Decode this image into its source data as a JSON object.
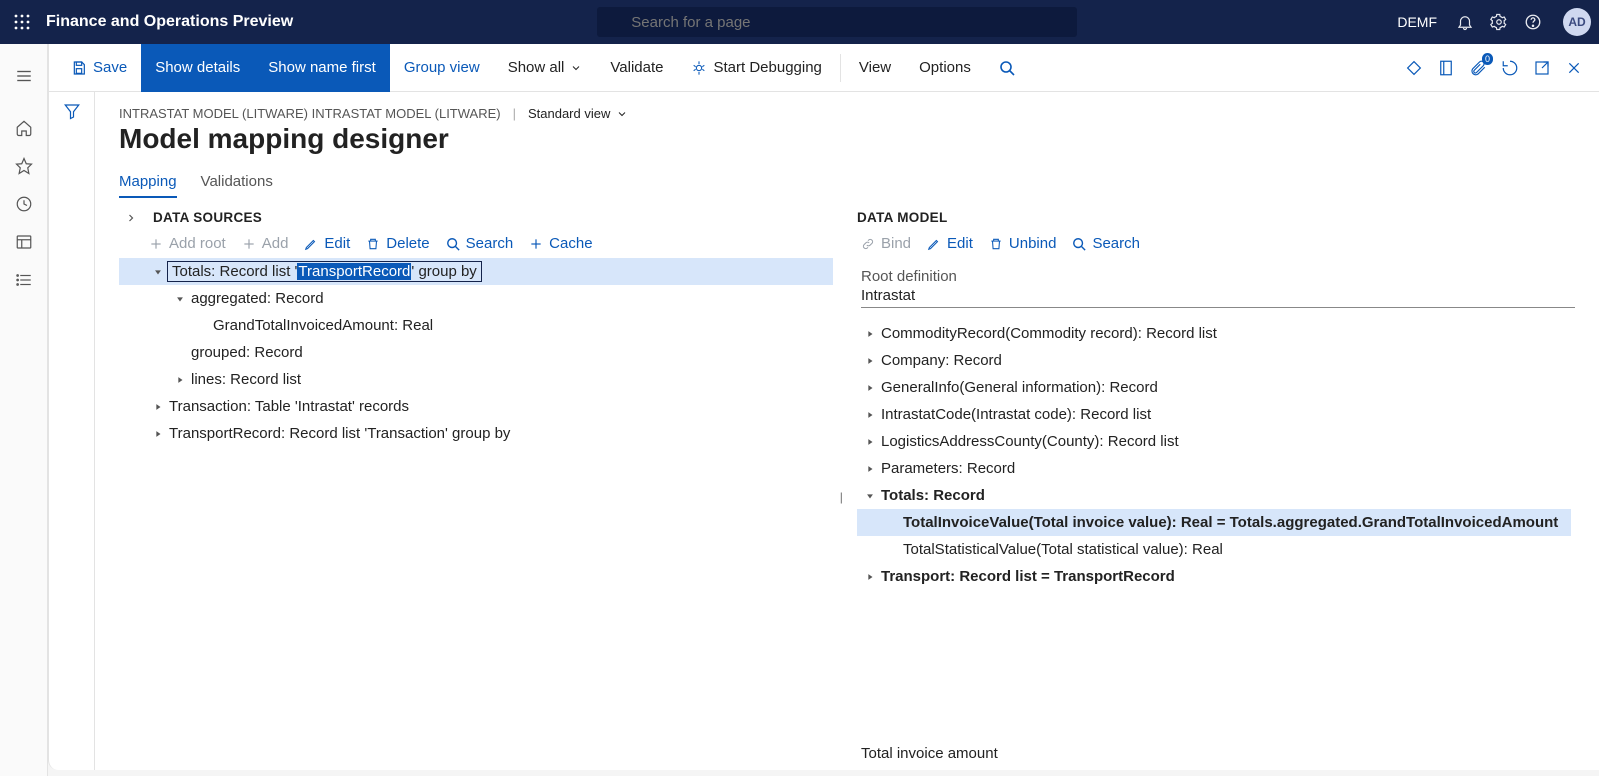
{
  "topbar": {
    "title": "Finance and Operations Preview",
    "search_placeholder": "Search for a page",
    "company": "DEMF",
    "avatar_initials": "AD"
  },
  "actionbar": {
    "save": "Save",
    "show_details": "Show details",
    "show_name_first": "Show name first",
    "group_view": "Group view",
    "show_all": "Show all",
    "validate": "Validate",
    "start_debugging": "Start Debugging",
    "view": "View",
    "options": "Options",
    "attach_badge": "0"
  },
  "breadcrumb": {
    "path1": "INTRASTAT MODEL (LITWARE) INTRASTAT MODEL (LITWARE)",
    "view_label": "Standard view"
  },
  "page_title": "Model mapping designer",
  "tabs": {
    "mapping": "Mapping",
    "validations": "Validations"
  },
  "ds": {
    "section_title": "DATA SOURCES",
    "toolbar": {
      "add_root": "Add root",
      "add": "Add",
      "edit": "Edit",
      "delete": "Delete",
      "search": "Search",
      "cache": "Cache"
    },
    "tree": {
      "totals_prefix": "Totals: Record list '",
      "totals_chip": "TransportRecord",
      "totals_suffix": "' group by",
      "aggregated": "aggregated: Record",
      "grand_total": "GrandTotalInvoicedAmount: Real",
      "grouped": "grouped: Record",
      "lines": "lines: Record list",
      "transaction": "Transaction: Table 'Intrastat' records",
      "transport_record": "TransportRecord: Record list 'Transaction' group by"
    }
  },
  "dm": {
    "section_title": "DATA MODEL",
    "toolbar": {
      "bind": "Bind",
      "edit": "Edit",
      "unbind": "Unbind",
      "search": "Search"
    },
    "root_label": "Root definition",
    "root_value": "Intrastat",
    "tree": {
      "commodity": "CommodityRecord(Commodity record): Record list",
      "company": "Company: Record",
      "generalinfo": "GeneralInfo(General information): Record",
      "intrastatcode": "IntrastatCode(Intrastat code): Record list",
      "logistics": "LogisticsAddressCounty(County): Record list",
      "parameters": "Parameters: Record",
      "totals": "Totals: Record",
      "total_invoice": "TotalInvoiceValue(Total invoice value): Real = Totals.aggregated.GrandTotalInvoicedAmount",
      "total_statistical": "TotalStatisticalValue(Total statistical value): Real",
      "transport": "Transport: Record list = TransportRecord"
    },
    "footer": "Total invoice amount"
  }
}
